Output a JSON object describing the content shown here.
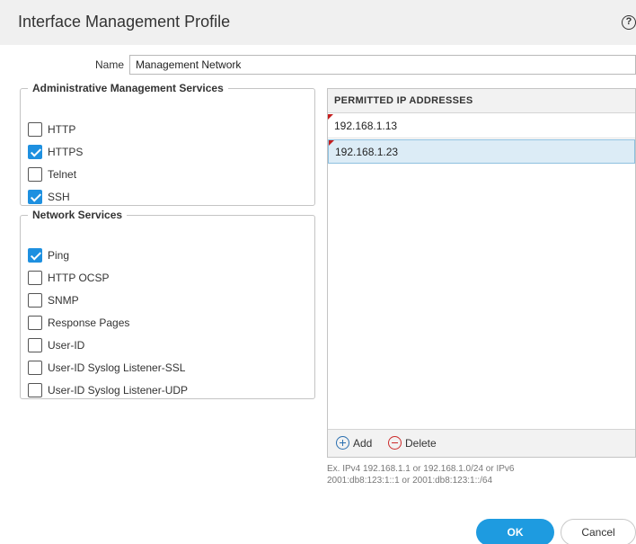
{
  "dialog": {
    "title": "Interface Management Profile",
    "help_icon": "help-circle-icon",
    "help_glyph": "?"
  },
  "name_field": {
    "label": "Name",
    "value": "Management Network"
  },
  "admin_services": {
    "legend": "Administrative Management Services",
    "items": [
      {
        "label": "HTTP",
        "checked": false
      },
      {
        "label": "HTTPS",
        "checked": true
      },
      {
        "label": "Telnet",
        "checked": false
      },
      {
        "label": "SSH",
        "checked": true
      }
    ]
  },
  "network_services": {
    "legend": "Network Services",
    "items": [
      {
        "label": "Ping",
        "checked": true
      },
      {
        "label": "HTTP OCSP",
        "checked": false
      },
      {
        "label": "SNMP",
        "checked": false
      },
      {
        "label": "Response Pages",
        "checked": false
      },
      {
        "label": "User-ID",
        "checked": false
      },
      {
        "label": "User-ID Syslog Listener-SSL",
        "checked": false
      },
      {
        "label": "User-ID Syslog Listener-UDP",
        "checked": false
      }
    ]
  },
  "permitted_ips": {
    "header": "PERMITTED IP ADDRESSES",
    "rows": [
      {
        "value": "192.168.1.13",
        "selected": false
      },
      {
        "value": "192.168.1.23",
        "selected": true
      }
    ],
    "add_label": "Add",
    "delete_label": "Delete",
    "hint_line1": "Ex. IPv4 192.168.1.1 or 192.168.1.0/24 or IPv6",
    "hint_line2": "2001:db8:123:1::1 or 2001:db8:123:1::/64"
  },
  "buttons": {
    "ok": "OK",
    "cancel": "Cancel"
  },
  "colors": {
    "accent": "#1e9be0",
    "checkbox_checked": "#1e90e0",
    "selected_row": "#dcecf6",
    "error_flag": "#c41e1e"
  }
}
